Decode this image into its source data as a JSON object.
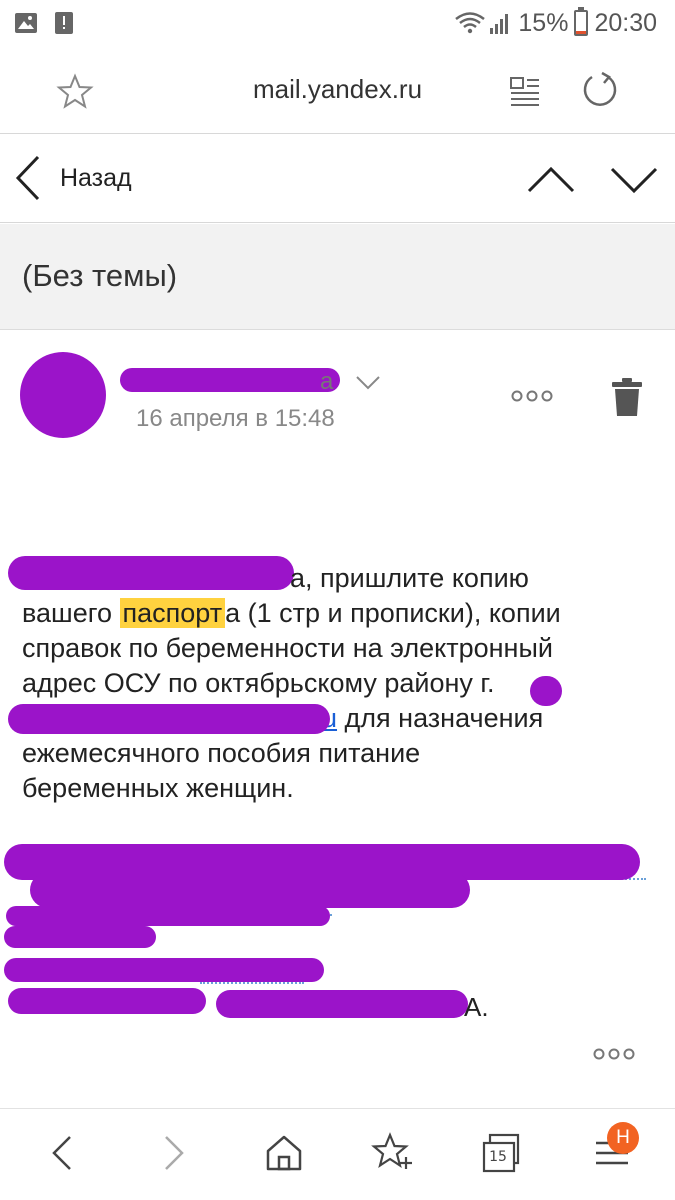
{
  "status_bar": {
    "battery": "15%",
    "time": "20:30",
    "battery_level": 0.15
  },
  "browser": {
    "url": "mail.yandex.ru",
    "tabs_count": "15",
    "profile_badge": "Н",
    "icons": [
      "bookmark-star-icon",
      "reader-mode-icon",
      "reload-icon",
      "back-arrow-icon",
      "forward-arrow-icon",
      "home-icon",
      "add-bookmark-icon",
      "tabs-icon",
      "menu-icon"
    ]
  },
  "mail_toolbar": {
    "back_label": "Назад"
  },
  "message": {
    "subject": "(Без темы)",
    "sender_suffix": "а",
    "date": "16 апреля в 15:48",
    "body": {
      "line1": "а, пришлите копию",
      "line2_a": "вашего ",
      "line2_highlight": "паспорт",
      "line2_b": "а (1 стр и прописки), копии",
      "line3": "справок по беременности на электронный",
      "line4": "адрес ОСУ по октябрьскому району г.",
      "line5_link": "u",
      "line5_b": " для назначения",
      "line6": "ежемесячного пособия питание",
      "line7": "беременных женщин."
    },
    "signature_tail": "А."
  },
  "colors": {
    "redaction": "#9b14c9",
    "highlight": "#ffd23f",
    "badge": "#f26322",
    "link": "#1a5fd6"
  }
}
